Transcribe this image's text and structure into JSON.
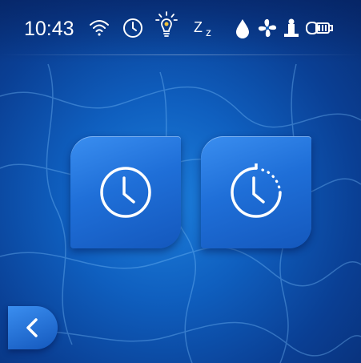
{
  "status_bar": {
    "time": "10:43",
    "icons": [
      "wifi-icon",
      "clock-icon",
      "light-bulb-icon",
      "sleep-icon",
      "water-drop-icon",
      "fan-icon",
      "fountain-icon",
      "pump-icon"
    ]
  },
  "main": {
    "tiles": [
      {
        "icon": "clock-icon"
      },
      {
        "icon": "timer-icon"
      }
    ]
  },
  "back_button": {
    "icon": "chevron-left-icon"
  },
  "colors": {
    "accent": "#2a7ee6",
    "background": "#0f5fbf"
  }
}
